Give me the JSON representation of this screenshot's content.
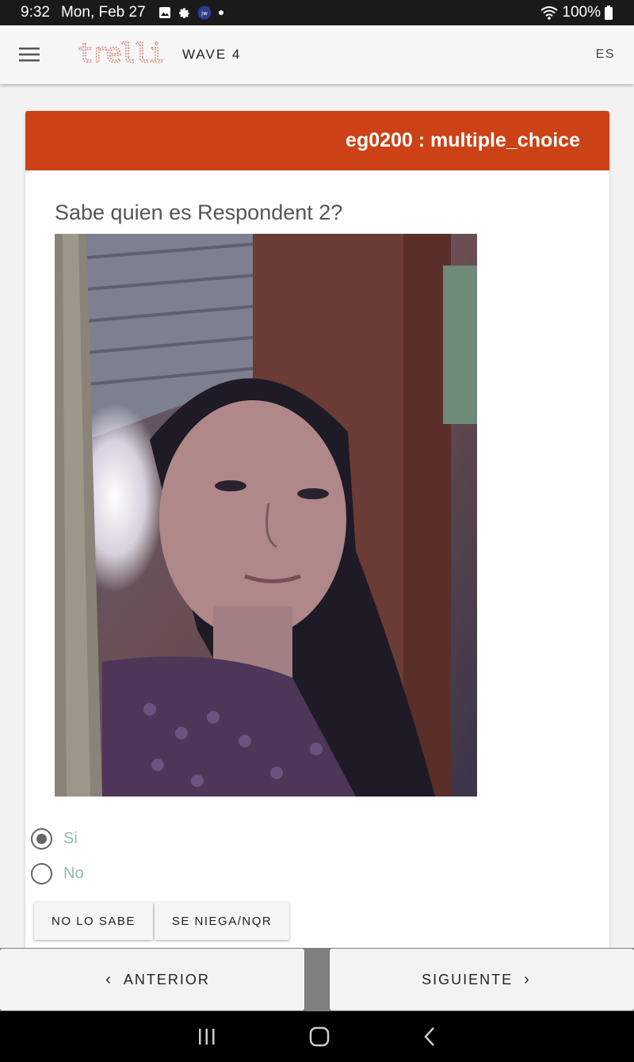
{
  "status_bar": {
    "time": "9:32",
    "date": "Mon, Feb 27",
    "battery": "100%",
    "icons": [
      "gallery-icon",
      "settings-gear-icon",
      "app-icon",
      "dot-icon",
      "wifi-icon",
      "battery-icon"
    ]
  },
  "app_bar": {
    "logo_text": "trellis",
    "survey_title": "WAVE 4",
    "language": "ES"
  },
  "question_card": {
    "header": "eg0200 : multiple_choice",
    "question_text": "Sabe quien es Respondent 2?",
    "options": [
      {
        "label": "Si",
        "selected": true
      },
      {
        "label": "No",
        "selected": false
      }
    ],
    "dk_button": "NO LO SABE",
    "rf_button": "SE NIEGA/NQR"
  },
  "navigation": {
    "prev_label": "ANTERIOR",
    "next_label": "SIGUIENTE"
  },
  "colors": {
    "header": "#cc4115",
    "option_text": "#8fbf9f",
    "logo": "#e08e85"
  }
}
